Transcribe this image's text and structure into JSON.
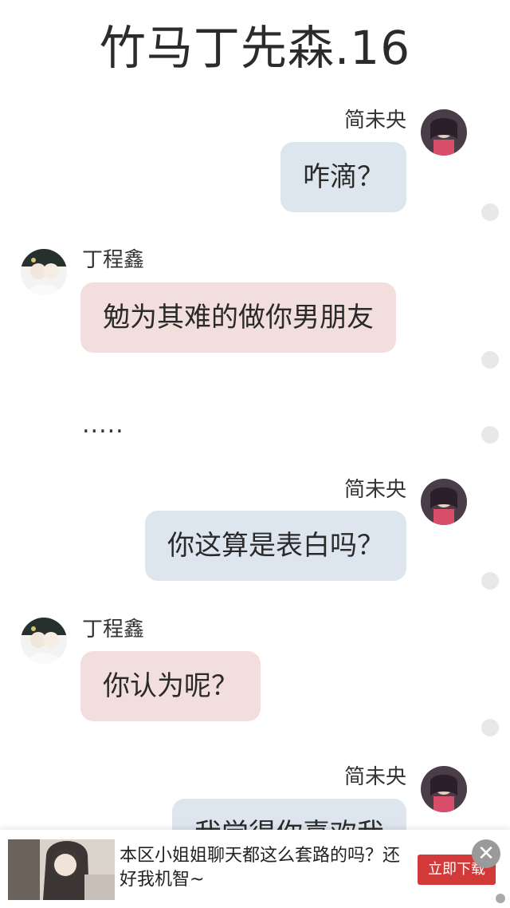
{
  "page": {
    "title": "竹马丁先森.16"
  },
  "messages": [
    {
      "side": "right",
      "sender": "简未央",
      "text": "咋滴？"
    },
    {
      "side": "left",
      "sender": "丁程鑫",
      "text": "勉为其难的做你男朋友"
    },
    {
      "side": "left",
      "sender": "",
      "text": "....."
    },
    {
      "side": "right",
      "sender": "简未央",
      "text": "你这算是表白吗？"
    },
    {
      "side": "left",
      "sender": "丁程鑫",
      "text": "你认为呢？"
    },
    {
      "side": "right",
      "sender": "简未央",
      "text": "我觉得你喜欢我"
    }
  ],
  "ad": {
    "text": "本区小姐姐聊天都这么套路的吗？还好我机智~",
    "cta_label": "立即下载",
    "close_icon": "close-icon"
  },
  "colors": {
    "right_bubble": "#dde5ee",
    "left_bubble": "#f3dede",
    "ad_button": "#d23a3a"
  }
}
